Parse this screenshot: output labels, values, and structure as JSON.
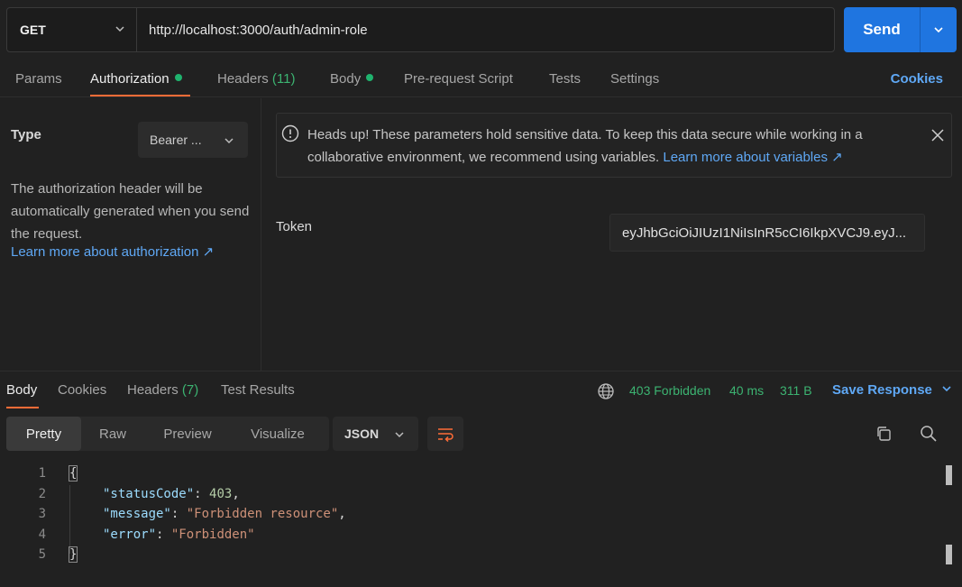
{
  "request": {
    "method": "GET",
    "url": "http://localhost:3000/auth/admin-role",
    "send_label": "Send"
  },
  "request_tabs": {
    "params": "Params",
    "authorization": "Authorization",
    "headers": "Headers",
    "headers_count": "(11)",
    "body": "Body",
    "pre_request": "Pre-request Script",
    "tests": "Tests",
    "settings": "Settings",
    "cookies": "Cookies"
  },
  "auth": {
    "type_label": "Type",
    "type_value": "Bearer ...",
    "description": "The authorization header will be automatically generated when you send the request.",
    "learn_more": "Learn more about authorization ↗"
  },
  "warning": {
    "text": "Heads up! These parameters hold sensitive data. To keep this data secure while working in a collaborative environment, we recommend using variables.",
    "link": "Learn more about variables ↗"
  },
  "token": {
    "label": "Token",
    "value": "eyJhbGciOiJIUzI1NiIsInR5cCI6IkpXVCJ9.eyJ..."
  },
  "response_tabs": {
    "body": "Body",
    "cookies": "Cookies",
    "headers": "Headers",
    "headers_count": "(7)",
    "test_results": "Test Results"
  },
  "response_meta": {
    "status": "403 Forbidden",
    "time": "40 ms",
    "size": "311 B",
    "save_response": "Save Response"
  },
  "view": {
    "pretty": "Pretty",
    "raw": "Raw",
    "preview": "Preview",
    "visualize": "Visualize",
    "format": "JSON"
  },
  "code": {
    "line_numbers": [
      "1",
      "2",
      "3",
      "4",
      "5"
    ],
    "open_brace": "{",
    "close_brace": "}",
    "lines": [
      {
        "key": "\"statusCode\"",
        "value": "403",
        "trail": ","
      },
      {
        "key": "\"message\"",
        "value": "\"Forbidden resource\"",
        "trail": ","
      },
      {
        "key": "\"error\"",
        "value": "\"Forbidden\"",
        "trail": ""
      }
    ]
  },
  "colors": {
    "accent": "#ff6c37",
    "send": "#1f75e0",
    "link": "#5fa8f5",
    "success": "#3cb371"
  }
}
